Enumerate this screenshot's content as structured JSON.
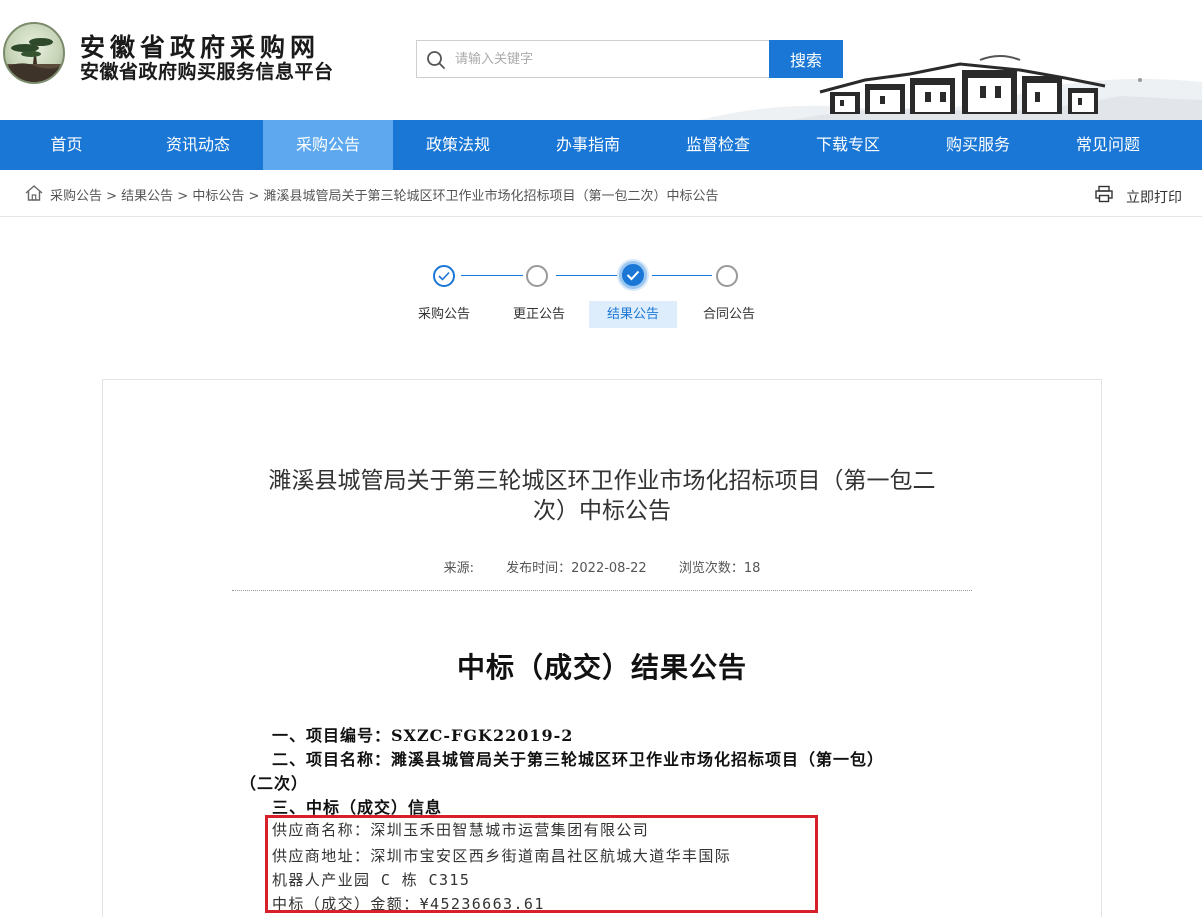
{
  "header": {
    "title": "安徽省政府采购网",
    "subtitle": "安徽省政府购买服务信息平台",
    "logo_icon": "pine-tree-logo-icon"
  },
  "search": {
    "placeholder": "请输入关键字",
    "button_label": "搜索"
  },
  "nav": {
    "items": [
      "首页",
      "资讯动态",
      "采购公告",
      "政策法规",
      "办事指南",
      "监督检查",
      "下载专区",
      "购买服务",
      "常见问题"
    ],
    "active_index": 2
  },
  "breadcrumb": {
    "text": "采购公告 > 结果公告 > 中标公告 > 濉溪县城管局关于第三轮城区环卫作业市场化招标项目（第一包二次）中标公告",
    "print_label": "立即打印"
  },
  "steps": {
    "items": [
      "采购公告",
      "更正公告",
      "结果公告",
      "合同公告"
    ],
    "current_index": 2
  },
  "article": {
    "title_line1": "濉溪县城管局关于第三轮城区环卫作业市场化招标项目（第一包二",
    "title_line2": "次）中标公告",
    "source_label": "来源:",
    "publish_label": "发布时间：2022-08-22",
    "views_label": "浏览次数：18",
    "heading": "中标（成交）结果公告",
    "lines": {
      "l1": "一、项目编号：SXZC-FGK22019-2",
      "l2": "二、项目名称：濉溪县城管局关于第三轮城区环卫作业市场化招标项目（第一包）",
      "l3": "（二次）",
      "l4": "三、中标（成交）信息",
      "supplier_name": "供应商名称：深圳玉禾田智慧城市运营集团有限公司",
      "supplier_addr1": "供应商地址：深圳市宝安区西乡街道南昌社区航城大道华丰国际",
      "supplier_addr2": "机器人产业园 C 栋 C315",
      "amount": "中标（成交）金额：¥45236663.61"
    }
  },
  "colors": {
    "brand_blue": "#1a77d6",
    "nav_active": "#5ea8ef",
    "highlight_red": "#d6202a"
  }
}
